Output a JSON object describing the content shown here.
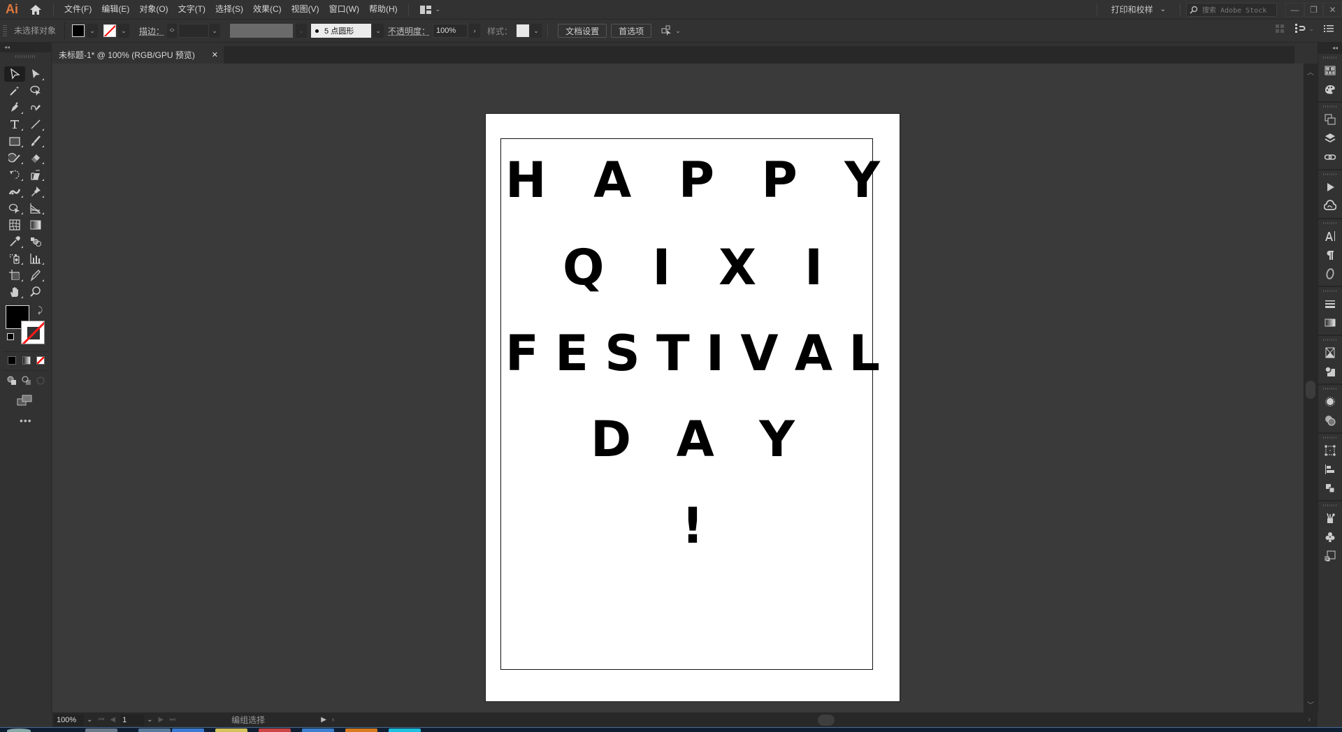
{
  "app": {
    "logo": "Ai",
    "brand_color": "#e3793d"
  },
  "menubar": {
    "items": [
      "文件(F)",
      "编辑(E)",
      "对象(O)",
      "文字(T)",
      "选择(S)",
      "效果(C)",
      "视图(V)",
      "窗口(W)",
      "帮助(H)"
    ],
    "workspace": "打印和校样",
    "stock_search_placeholder": "搜索 Adobe Stock"
  },
  "controlbar": {
    "selection_status": "未选择对象",
    "stroke_label": "描边：",
    "brush_value": "5 点圆形",
    "opacity_label": "不透明度：",
    "opacity_value": "100%",
    "style_label": "样式：",
    "doc_setup_button": "文档设置",
    "preferences_button": "首选项"
  },
  "tabs": [
    {
      "label": "未标题-1* @ 100% (RGB/GPU 预览)",
      "close": "✕",
      "active": true
    }
  ],
  "artboard": {
    "lines": [
      [
        "H",
        "A",
        "P",
        "P",
        "Y"
      ],
      [
        "Q",
        "I",
        "X",
        "I"
      ],
      [
        "F",
        "E",
        "S",
        "T",
        "I",
        "V",
        "A",
        "L"
      ],
      [
        "D",
        "A",
        "Y"
      ],
      [
        "!"
      ]
    ],
    "text_color": "#000000",
    "background": "#ffffff"
  },
  "statusbar": {
    "zoom": "100%",
    "artboard_number": "1",
    "status_text": "编组选择"
  },
  "fill_color": "#000000",
  "stroke_color": "none"
}
